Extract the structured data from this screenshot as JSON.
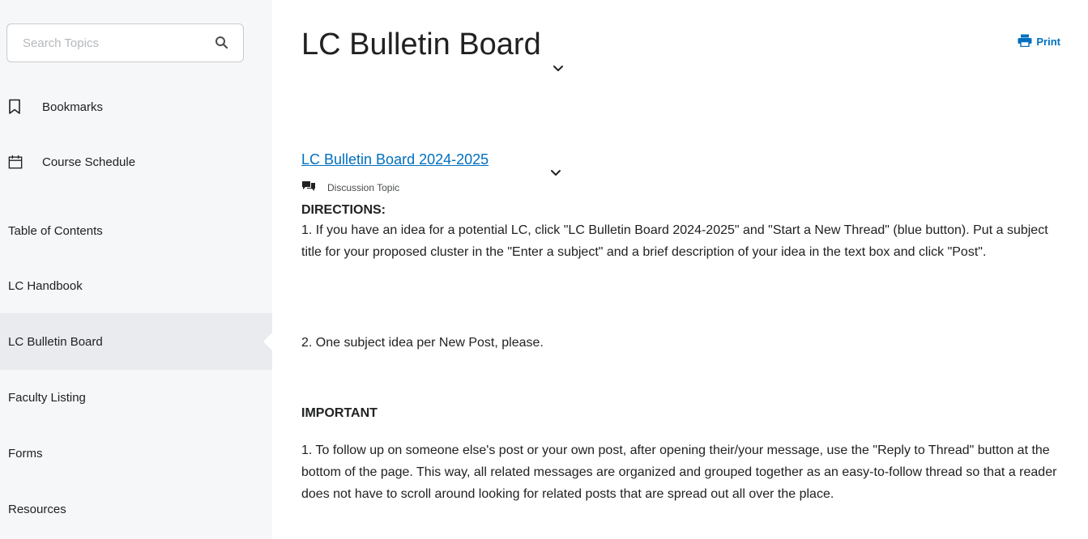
{
  "sidebar": {
    "search": {
      "placeholder": "Search Topics",
      "value": ""
    },
    "items": [
      {
        "label": "Bookmarks",
        "icon": "bookmark-icon"
      },
      {
        "label": "Course Schedule",
        "icon": "calendar-icon"
      },
      {
        "label": "Table of Contents"
      },
      {
        "label": "LC Handbook"
      },
      {
        "label": "LC Bulletin Board",
        "active": true
      },
      {
        "label": "Faculty Listing"
      },
      {
        "label": "Forms"
      },
      {
        "label": "Resources"
      }
    ]
  },
  "main": {
    "title": "LC Bulletin Board",
    "print_label": "Print",
    "topic": {
      "link": "LC Bulletin Board 2024-2025",
      "type": "Discussion Topic"
    },
    "directions_heading": "DIRECTIONS:",
    "direction_1": "1. If you have an idea for a potential LC, click \"LC Bulletin Board 2024-2025\" and \"Start a New Thread\" (blue button). Put a subject title for your proposed cluster in the \"Enter a subject\" and a brief description of your idea in the text box and click \"Post\".",
    "direction_2": "2. One subject idea per New Post, please.",
    "important_heading": "IMPORTANT",
    "important_1": "1. To follow up on someone else's post or your own post, after opening their/your message, use the \"Reply to Thread\" button at the bottom of the page. This way, all related messages are organized and grouped together as an easy-to-follow thread so that a reader does not have to scroll around looking for related posts that are spread out all over the place."
  },
  "colors": {
    "link": "#006fbf",
    "sidebar_bg": "#f6f7f8",
    "active_bg": "#e9ebef"
  }
}
